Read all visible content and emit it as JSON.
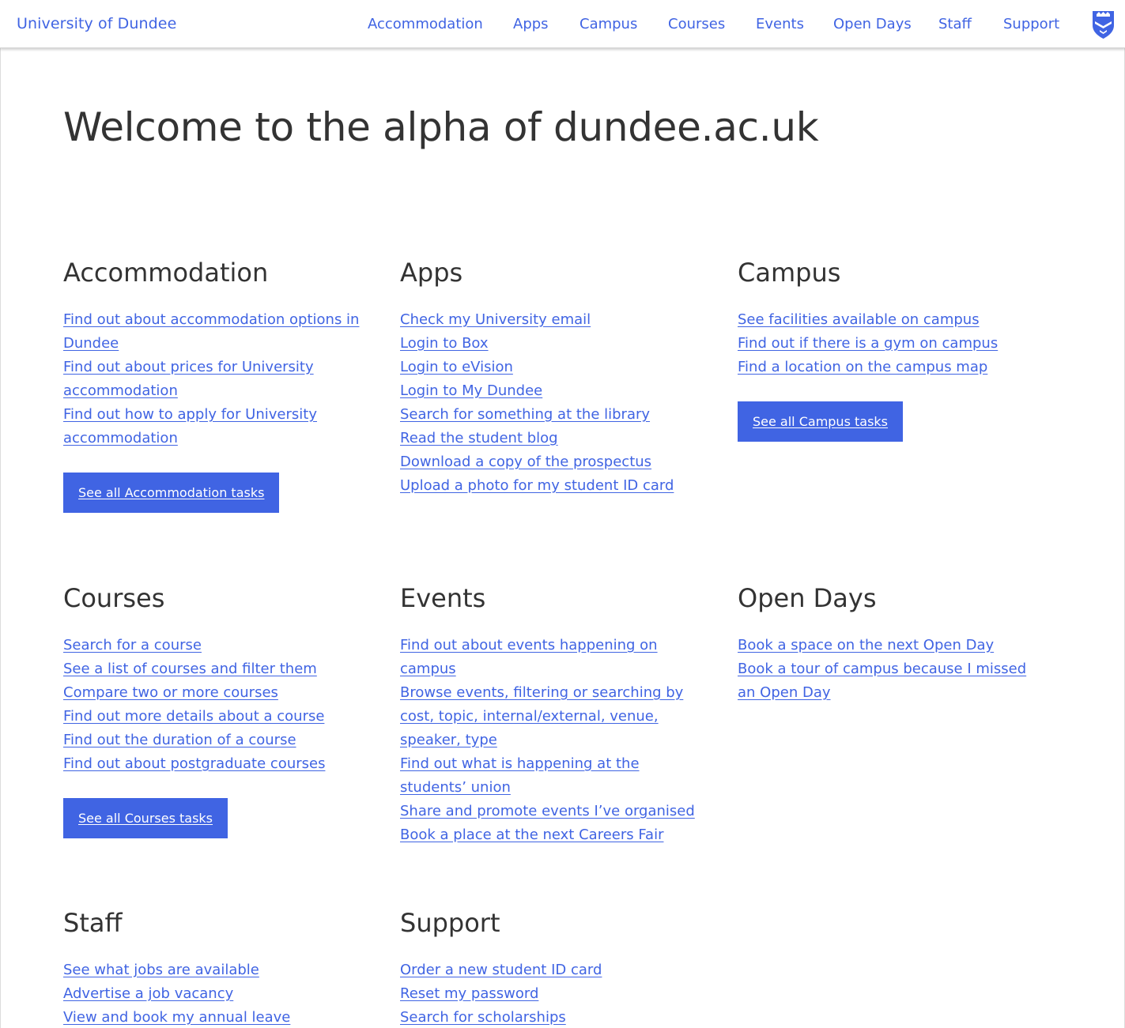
{
  "header": {
    "brand": "University of Dundee",
    "nav": [
      "Accommodation",
      "Apps",
      "Campus",
      "Courses",
      "Events",
      "Open Days",
      "Staff",
      "Support"
    ],
    "crest_icon": "shield-crest-icon"
  },
  "hero": {
    "title": "Welcome to the alpha of dundee.ac.uk"
  },
  "colors": {
    "accent": "#4064e3",
    "text": "#333333"
  },
  "sections": [
    {
      "title": "Accommodation",
      "links": [
        "Find out about accommodation options in Dundee",
        "Find out about prices for University accommodation",
        "Find out how to apply for University accommodation"
      ],
      "button": "See all Accommodation tasks"
    },
    {
      "title": "Apps",
      "links": [
        "Check my University email",
        "Login to Box",
        "Login to eVision",
        "Login to My Dundee",
        "Search for something at the library",
        "Read the student blog",
        "Download a copy of the prospectus",
        "Upload a photo for my student ID card"
      ],
      "button": ""
    },
    {
      "title": "Campus",
      "links": [
        "See facilities available on campus",
        "Find out if there is a gym on campus",
        "Find a location on the campus map"
      ],
      "button": "See all Campus tasks"
    },
    {
      "title": "Courses",
      "links": [
        "Search for a course",
        "See a list of courses and filter them",
        "Compare two or more courses",
        "Find out more details about a course",
        "Find out the duration of a course",
        "Find out about postgraduate courses"
      ],
      "button": "See all Courses tasks"
    },
    {
      "title": "Events",
      "links": [
        "Find out about events happening on campus",
        "Browse events, filtering or searching by cost, topic, internal/external, venue, speaker, type",
        "Find out what is happening at the students’ union",
        "Share and promote events I’ve organised",
        "Book a place at the next Careers Fair"
      ],
      "button": ""
    },
    {
      "title": "Open Days",
      "links": [
        "Book a space on the next Open Day",
        "Book a tour of campus because I missed an Open Day"
      ],
      "button": ""
    },
    {
      "title": "Staff",
      "links": [
        "See what jobs are available",
        "Advertise a job vacancy",
        "View and book my annual leave"
      ],
      "button": ""
    },
    {
      "title": "Support",
      "links": [
        "Order a new student ID card",
        "Reset my password",
        "Search for scholarships"
      ],
      "button": ""
    }
  ]
}
